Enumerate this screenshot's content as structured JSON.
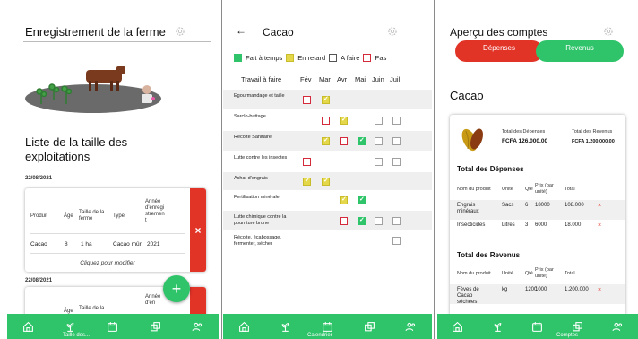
{
  "colors": {
    "green": "#2fc46a",
    "red": "#e23327",
    "yellow": "#e4d84a",
    "pink_border": "#d42a3b",
    "grey_border": "#a0a0a0"
  },
  "icons": [
    "settings-gear-icon",
    "home-icon",
    "plant-icon",
    "calendar-icon",
    "coins-icon",
    "people-icon",
    "back-arrow-icon",
    "plus-icon",
    "delete-x-icon",
    "cocoa-pod-icon"
  ],
  "farm_registration": {
    "title": "Enregistrement de la ferme",
    "list_title": "Liste de la taille des exploitations",
    "cards": [
      {
        "date": "22/08/2021",
        "headers": {
          "product": "Produit",
          "age": "Âge",
          "size": "Taille de la ferme",
          "type": "Type",
          "year": "Année d'enregistrement"
        },
        "values": {
          "product": "Cacao",
          "age": "8",
          "size": "1 ha",
          "type": "Cacao mûr",
          "year": "2021"
        },
        "modify_label": "Cliquez pour modifier",
        "delete_label": "×"
      },
      {
        "date": "22/08/2021",
        "headers": {
          "age": "Âge",
          "size": "Taille de la",
          "year": "Année d'en"
        }
      }
    ],
    "fab_label": "+",
    "nav_caption": "Taille des..."
  },
  "calendar": {
    "title": "Cacao",
    "back_label": "←",
    "legend": [
      {
        "label": "Fait à temps",
        "status": "done"
      },
      {
        "label": "En retard",
        "status": "late"
      },
      {
        "label": "A faire",
        "status": "todo"
      },
      {
        "label": "Pas",
        "status": "miss"
      }
    ],
    "task_header": "Travail à faire",
    "months": [
      "Fév",
      "Mar",
      "Avr",
      "Mai",
      "Juin",
      "Juil"
    ],
    "tasks": [
      {
        "label": "Egourmandage et taille",
        "cells": [
          "miss",
          "late",
          null,
          null,
          null,
          null
        ]
      },
      {
        "label": "Sarclo-buttage",
        "cells": [
          null,
          "miss",
          "late",
          null,
          "todo",
          "todo"
        ]
      },
      {
        "label": "Récolte Sanitaire",
        "cells": [
          null,
          "late",
          "miss",
          "done",
          "todo",
          "todo"
        ]
      },
      {
        "label": "Lutte contre les insectes",
        "cells": [
          "miss",
          null,
          null,
          null,
          "todo",
          "todo"
        ]
      },
      {
        "label": "Achat d'engrais",
        "cells": [
          "late",
          "late",
          null,
          null,
          null,
          null
        ]
      },
      {
        "label": "Fertilisation minérale",
        "cells": [
          null,
          null,
          "late",
          "done",
          null,
          null
        ]
      },
      {
        "label": "Lutte chimique contre la pourriture brune",
        "cells": [
          null,
          null,
          "miss",
          "done",
          "todo",
          "todo"
        ]
      },
      {
        "label": "Récolte, écabossage, fermenter, sécher",
        "cells": [
          null,
          null,
          null,
          null,
          null,
          "todo"
        ]
      }
    ],
    "nav_caption": "Calendrier"
  },
  "accounts": {
    "title": "Aperçu des comptes",
    "expenses_button": "Dépenses",
    "revenue_button": "Revenus",
    "crop": "Cacao",
    "total_expenses_caption": "Total des Dépenses",
    "total_expenses_amount": "FCFA 126.000,00",
    "total_revenue_caption": "Total des Revenus",
    "total_revenue_amount": "FCFA 1.200.000,00",
    "expenses_section": "Total des Dépenses",
    "revenue_section": "Total des Revenus",
    "table_headers": {
      "name": "Nom du produit",
      "unit": "Unité",
      "qty": "Qté",
      "price": "Prix (par unité)",
      "total": "Total"
    },
    "expenses": [
      {
        "name": "Engrais minéraux",
        "unit": "Sacs",
        "qty": "6",
        "price": "18000",
        "total": "108.000"
      },
      {
        "name": "Insecticides",
        "unit": "Litres",
        "qty": "3",
        "price": "6000",
        "total": "18.000"
      }
    ],
    "revenues": [
      {
        "name": "Fèves de Cacao séchées",
        "unit": "kg",
        "qty": "1200",
        "price": "1000",
        "total": "1.200.000"
      }
    ],
    "delete_label": "×",
    "nav_caption": "Comptes"
  }
}
